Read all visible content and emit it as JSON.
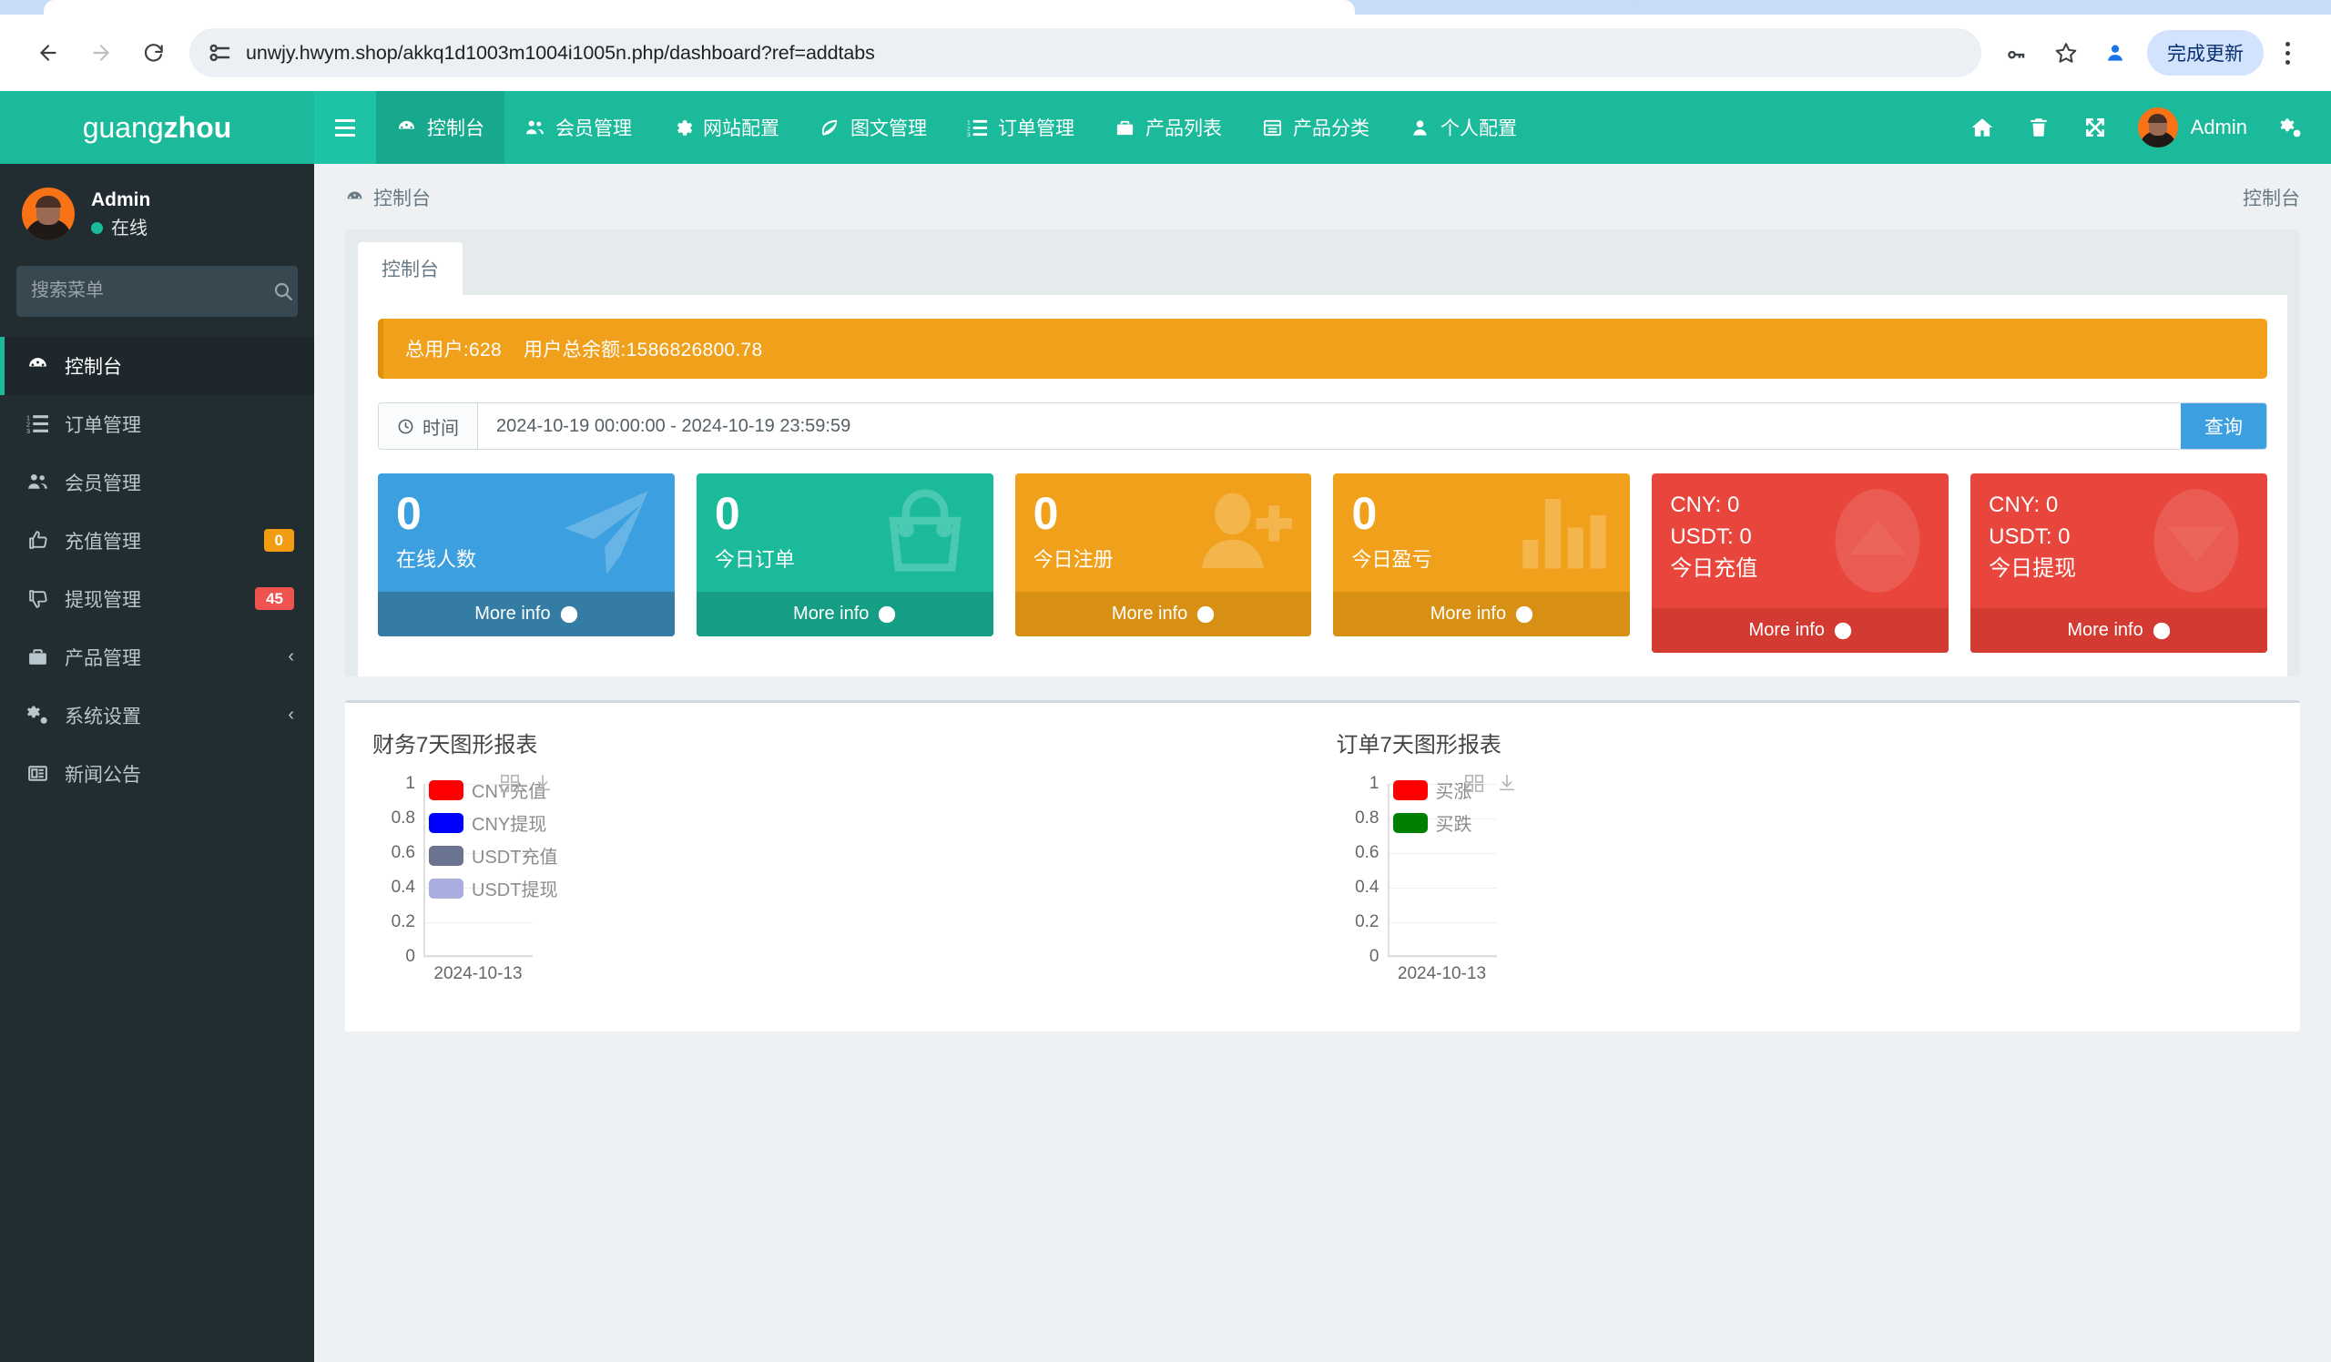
{
  "browser": {
    "url": "unwjy.hwym.shop/akkq1d1003m1004i1005n.php/dashboard?ref=addtabs",
    "back_label": "back-arrow",
    "forward_label": "forward-arrow",
    "reload_label": "reload",
    "update_button": "完成更新"
  },
  "sidebar": {
    "brand_part1": "guang",
    "brand_part2": "zhou",
    "user_name": "Admin",
    "user_status": "在线",
    "search_placeholder": "搜索菜单",
    "items": [
      {
        "label": "控制台",
        "icon": "dashboard-icon",
        "badge": "",
        "chevron": ""
      },
      {
        "label": "订单管理",
        "icon": "list-icon",
        "badge": "",
        "chevron": ""
      },
      {
        "label": "会员管理",
        "icon": "users-icon",
        "badge": "",
        "chevron": ""
      },
      {
        "label": "充值管理",
        "icon": "thumbs-up-icon",
        "badge": "0",
        "badge_kind": "warn",
        "chevron": ""
      },
      {
        "label": "提现管理",
        "icon": "thumbs-down-icon",
        "badge": "45",
        "badge_kind": "danger",
        "chevron": ""
      },
      {
        "label": "产品管理",
        "icon": "briefcase-icon",
        "badge": "",
        "chevron": "‹"
      },
      {
        "label": "系统设置",
        "icon": "gears-icon",
        "badge": "",
        "chevron": "‹"
      },
      {
        "label": "新闻公告",
        "icon": "newspaper-icon",
        "badge": "",
        "chevron": ""
      }
    ]
  },
  "navbar": {
    "links": [
      {
        "label": "控制台",
        "icon": "dashboard-icon",
        "current": true
      },
      {
        "label": "会员管理",
        "icon": "users-icon",
        "current": false
      },
      {
        "label": "网站配置",
        "icon": "gear-icon",
        "current": false
      },
      {
        "label": "图文管理",
        "icon": "leaf-icon",
        "current": false
      },
      {
        "label": "订单管理",
        "icon": "list-ol-icon",
        "current": false
      },
      {
        "label": "产品列表",
        "icon": "briefcase-icon",
        "current": false
      },
      {
        "label": "产品分类",
        "icon": "window-icon",
        "current": false
      },
      {
        "label": "个人配置",
        "icon": "user-icon",
        "current": false
      }
    ],
    "user_name": "Admin"
  },
  "page": {
    "breadcrumb": "控制台",
    "breadcrumb_right": "控制台",
    "tab_label": "控制台",
    "alert_total_users": "总用户:628",
    "alert_total_balance": "用户总余额:1586826800.78",
    "filter_label": "时间",
    "filter_value": "2024-10-19 00:00:00 - 2024-10-19 23:59:59",
    "filter_submit": "查询"
  },
  "cards": [
    {
      "value": "0",
      "text": "在线人数",
      "more": "More info",
      "theme": "card-aqua",
      "icon": "paper-plane-icon"
    },
    {
      "value": "0",
      "text": "今日订单",
      "more": "More info",
      "theme": "card-green",
      "icon": "shopping-bag-icon"
    },
    {
      "value": "0",
      "text": "今日注册",
      "more": "More info",
      "theme": "card-yellow",
      "icon": "user-plus-icon"
    },
    {
      "value": "0",
      "text": "今日盈亏",
      "more": "More info",
      "theme": "card-yellow",
      "icon": "bar-chart-icon"
    }
  ],
  "money_cards": [
    {
      "cny_label": "CNY:",
      "cny_value": "0",
      "usdt_label": "USDT:",
      "usdt_value": "0",
      "text": "今日充值",
      "more": "More info",
      "theme": "card-red",
      "icon": "caret-up-icon"
    },
    {
      "cny_label": "CNY:",
      "cny_value": "0",
      "usdt_label": "USDT:",
      "usdt_value": "0",
      "text": "今日提现",
      "more": "More info",
      "theme": "card-red",
      "icon": "caret-down-icon"
    }
  ],
  "chart_data": [
    {
      "type": "bar",
      "title": "财务7天图形报表",
      "categories": [
        "2024-10-13"
      ],
      "series": [
        {
          "name": "CNY充值",
          "color": "#ff0000",
          "values": [
            0
          ]
        },
        {
          "name": "CNY提现",
          "color": "#0000ff",
          "values": [
            0
          ]
        },
        {
          "name": "USDT充值",
          "color": "#6a7490",
          "values": [
            0
          ]
        },
        {
          "name": "USDT提现",
          "color": "#a9aede",
          "values": [
            0
          ]
        }
      ],
      "xlabel": "",
      "ylabel": "",
      "ylim": [
        0,
        1
      ],
      "yticks": [
        "1",
        "0.8",
        "0.6",
        "0.4",
        "0.2",
        "0"
      ],
      "grid": true,
      "legend_position": "top-left"
    },
    {
      "type": "bar",
      "title": "订单7天图形报表",
      "categories": [
        "2024-10-13"
      ],
      "series": [
        {
          "name": "买涨",
          "color": "#ff0000",
          "values": [
            0
          ]
        },
        {
          "name": "买跌",
          "color": "#008000",
          "values": [
            0
          ]
        }
      ],
      "xlabel": "",
      "ylabel": "",
      "ylim": [
        0,
        1
      ],
      "yticks": [
        "1",
        "0.8",
        "0.6",
        "0.4",
        "0.2",
        "0"
      ],
      "grid": true,
      "legend_position": "top-left"
    }
  ]
}
